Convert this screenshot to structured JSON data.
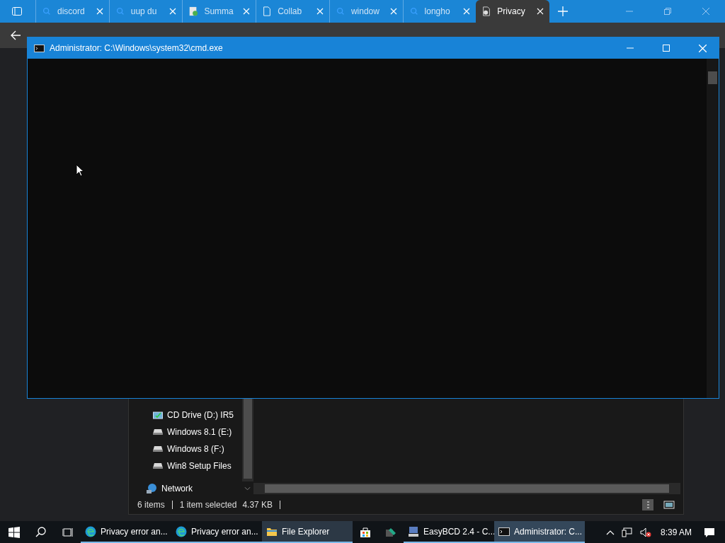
{
  "browser": {
    "tabs": [
      {
        "title": "discord",
        "kind": "search",
        "selected": false
      },
      {
        "title": "uup du",
        "kind": "search",
        "selected": false
      },
      {
        "title": "Summa",
        "kind": "sheet",
        "selected": false
      },
      {
        "title": "Collab",
        "kind": "page",
        "selected": false
      },
      {
        "title": "window",
        "kind": "search",
        "selected": false
      },
      {
        "title": "longho",
        "kind": "search",
        "selected": false
      },
      {
        "title": "Privacy",
        "kind": "warning",
        "selected": true
      }
    ]
  },
  "explorer": {
    "drives": [
      {
        "label": "CD Drive (D:) IR5",
        "kind": "cd"
      },
      {
        "label": "Windows 8.1 (E:)",
        "kind": "disk"
      },
      {
        "label": "Windows 8 (F:)",
        "kind": "disk"
      },
      {
        "label": "Win8 Setup Files",
        "kind": "disk"
      }
    ],
    "network": "Network",
    "status": {
      "items": "6 items",
      "selected": "1 item selected",
      "size": "4.37 KB"
    }
  },
  "cmd": {
    "title": "Administrator: C:\\Windows\\system32\\cmd.exe"
  },
  "taskbar": {
    "items": [
      {
        "label": "Privacy error an...",
        "kind": "edge",
        "selected": false,
        "hovered": false
      },
      {
        "label": "Privacy error an...",
        "kind": "edge",
        "selected": false,
        "hovered": false
      },
      {
        "label": "File Explorer",
        "kind": "folder",
        "selected": false,
        "hovered": true
      },
      {
        "kind": "store",
        "selected": false,
        "hovered": false
      },
      {
        "kind": "tool",
        "selected": false,
        "hovered": false
      },
      {
        "label": "EasyBCD 2.4 - C...",
        "kind": "easybcd",
        "selected": false,
        "hovered": false
      },
      {
        "label": "Administrator: C...",
        "kind": "cmd",
        "selected": true,
        "hovered": false
      }
    ],
    "time": "8:39 AM"
  }
}
